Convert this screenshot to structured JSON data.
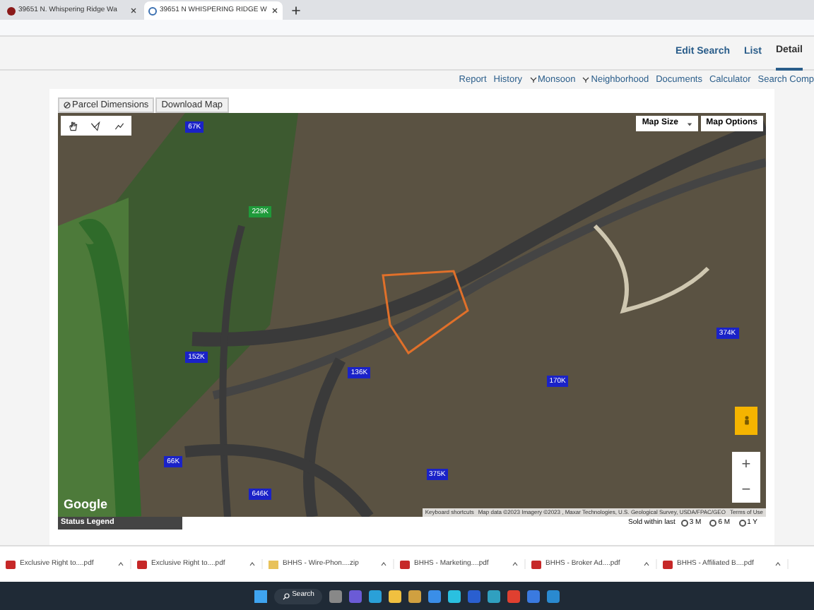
{
  "browser_tabs": [
    {
      "title": "39651 N. Whispering Ridge Wa",
      "selected": false
    },
    {
      "title": "39651 N WHISPERING RIDGE W",
      "selected": true
    }
  ],
  "header_nav": [
    {
      "label": "Edit Search",
      "selected": false
    },
    {
      "label": "List",
      "selected": false
    },
    {
      "label": "Detail",
      "selected": true
    }
  ],
  "sub_nav": [
    {
      "label": "Report",
      "icon": false
    },
    {
      "label": "History",
      "icon": false
    },
    {
      "label": "Monsoon",
      "icon": true
    },
    {
      "label": "Neighborhood",
      "icon": true
    },
    {
      "label": "Documents",
      "icon": false
    },
    {
      "label": "Calculator",
      "icon": false
    },
    {
      "label": "Search Comp",
      "icon": false
    }
  ],
  "map_tabs": [
    "Parcel Dimensions",
    "Download Map"
  ],
  "map_buttons": {
    "size": "Map Size",
    "options": "Map Options"
  },
  "markers": [
    {
      "label": "67K",
      "color": "#1a22c8"
    },
    {
      "label": "229K",
      "color": "#1f9a3a"
    },
    {
      "label": "152K",
      "color": "#1a22c8"
    },
    {
      "label": "136K",
      "color": "#1a22c8"
    },
    {
      "label": "170K",
      "color": "#1a22c8"
    },
    {
      "label": "374K",
      "color": "#1a22c8"
    },
    {
      "label": "66K",
      "color": "#1a22c8"
    },
    {
      "label": "375K",
      "color": "#1a22c8"
    },
    {
      "label": "646K",
      "color": "#1a22c8"
    }
  ],
  "map_logo": "Google",
  "attribution": [
    "Keyboard shortcuts",
    "Map data ©2023 Imagery ©2023 , Maxar Technologies, U.S. Geological Survey, USDA/FPAC/GEO",
    "Terms of Use"
  ],
  "zoom": [
    "+",
    "−"
  ],
  "status_legend": {
    "title": "Status Legend",
    "sold_label": "Sold within last",
    "options": [
      {
        "label": "3 M",
        "selected": false
      },
      {
        "label": "6 M",
        "selected": false
      },
      {
        "label": "1 Y",
        "selected": false
      }
    ]
  },
  "downloads": [
    {
      "name": "Exclusive Right to....pdf",
      "kind": "pdf"
    },
    {
      "name": "Exclusive Right to....pdf",
      "kind": "pdf"
    },
    {
      "name": "BHHS - Wire-Phon....zip",
      "kind": "zip"
    },
    {
      "name": "BHHS - Marketing....pdf",
      "kind": "pdf"
    },
    {
      "name": "BHHS - Broker Ad....pdf",
      "kind": "pdf"
    },
    {
      "name": "BHHS - Affiliated B....pdf",
      "kind": "pdf"
    }
  ],
  "taskbar": {
    "search": "Search"
  }
}
